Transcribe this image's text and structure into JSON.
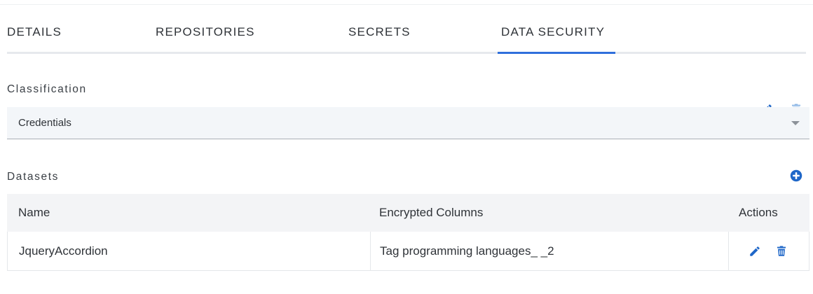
{
  "tabs": [
    {
      "label": "DETAILS"
    },
    {
      "label": "REPOSITORIES"
    },
    {
      "label": "SECRETS"
    },
    {
      "label": "DATA SECURITY",
      "active": true
    }
  ],
  "classification": {
    "label": "Classification",
    "selected_value": "Credentials",
    "icons": [
      "pencil-icon",
      "trash-icon",
      "chevron-down-icon"
    ]
  },
  "datasets": {
    "label": "Datasets",
    "add_icon": "plus-circle-icon",
    "columns": {
      "name": "Name",
      "encrypted": "Encrypted Columns",
      "actions": "Actions"
    },
    "rows": [
      {
        "name": "JqueryAccordion",
        "encrypted": "Tag programming languages_ _2",
        "action_icons": [
          "pencil-icon",
          "trash-icon"
        ]
      }
    ]
  },
  "colors": {
    "accent": "#2f6fdc",
    "icon_blue": "#1f67c8",
    "icon_blue_light": "#8db7e6",
    "select_bg": "#f3f6f9",
    "header_bg": "#f3f4f6"
  }
}
